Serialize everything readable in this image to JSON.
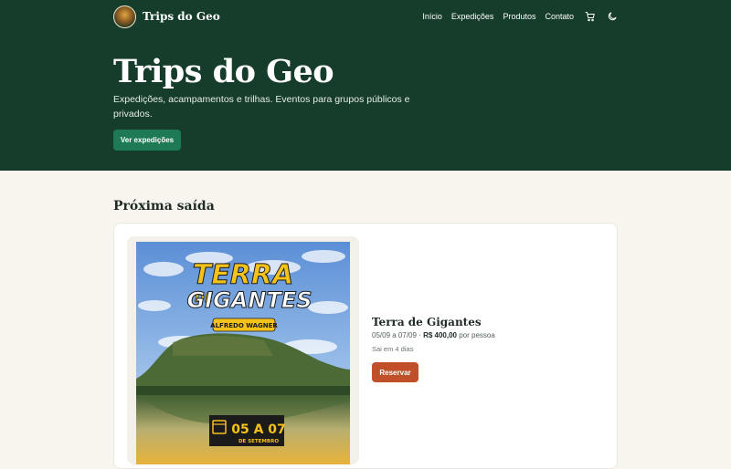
{
  "header": {
    "brand": "Trips do Geo",
    "nav": [
      "Início",
      "Expedições",
      "Produtos",
      "Contato"
    ],
    "icons": [
      "cart-icon",
      "moon-icon"
    ]
  },
  "hero": {
    "title": "Trips do Geo",
    "subtitle": "Expedições, acampamentos e trilhas. Eventos para grupos públicos e privados.",
    "cta": "Ver expedições"
  },
  "next": {
    "heading": "Próxima saída",
    "trip": {
      "title": "Terra de Gigantes",
      "dates": "05/09 a 07/09 ·",
      "price": "R$ 400,00",
      "price_suffix": "por pessoa",
      "departs": "Sai em 4 dias",
      "cta": "Reservar"
    },
    "poster": {
      "title_line1": "TERRA",
      "title_small": "DE",
      "title_line2": "GIGANTES",
      "guide": "ALFREDO WAGNER",
      "date_big": "05 A 07",
      "date_small": "DE SETEMBRO"
    }
  },
  "colors": {
    "hero_bg": "#163d2b",
    "primary_button": "#1e7a55",
    "reserve_button": "#c0502a",
    "page_bg": "#f8f5ef"
  }
}
